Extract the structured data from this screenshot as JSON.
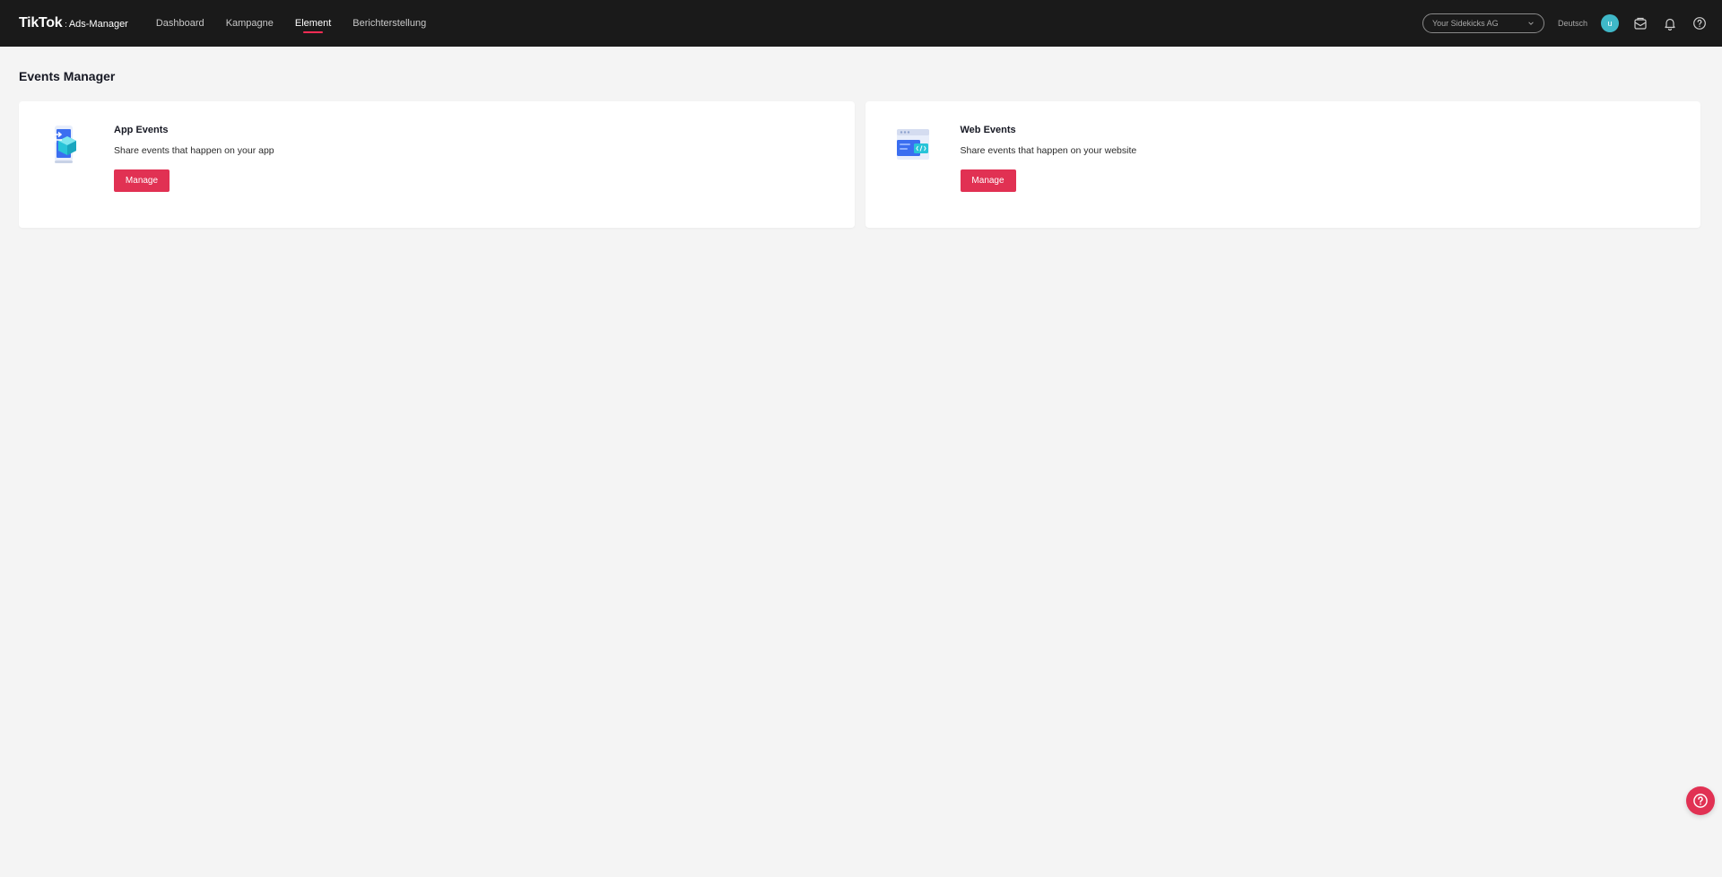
{
  "brand": {
    "logo": "TikTok",
    "separator": ":",
    "product": "Ads-Manager"
  },
  "nav": {
    "items": [
      {
        "label": "Dashboard",
        "active": false
      },
      {
        "label": "Kampagne",
        "active": false
      },
      {
        "label": "Element",
        "active": true
      },
      {
        "label": "Berichterstellung",
        "active": false
      }
    ]
  },
  "header": {
    "account": "Your Sidekicks AG",
    "language": "Deutsch",
    "avatar_initial": "u"
  },
  "page": {
    "title": "Events Manager"
  },
  "cards": [
    {
      "title": "App Events",
      "description": "Share events that happen on your app",
      "button": "Manage"
    },
    {
      "title": "Web Events",
      "description": "Share events that happen on your website",
      "button": "Manage"
    }
  ],
  "colors": {
    "accent": "#e13153",
    "topbar": "#1a1a1a",
    "avatar": "#3fb8c8",
    "background": "#f4f4f4"
  }
}
